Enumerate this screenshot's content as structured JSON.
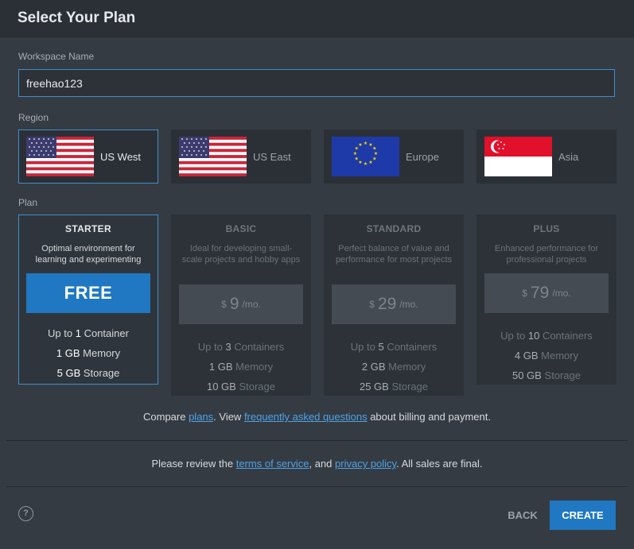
{
  "header": {
    "title": "Select Your Plan"
  },
  "workspace": {
    "label": "Workspace Name",
    "value": "freehao123"
  },
  "region": {
    "label": "Region",
    "selected": "US West",
    "items": [
      {
        "name": "US West",
        "flag": "us-flag-icon"
      },
      {
        "name": "US East",
        "flag": "us-flag-icon"
      },
      {
        "name": "Europe",
        "flag": "eu-flag-icon"
      },
      {
        "name": "Asia",
        "flag": "singapore-flag-icon"
      }
    ]
  },
  "plan": {
    "label": "Plan",
    "selected": "STARTER",
    "items": [
      {
        "name": "STARTER",
        "desc": "Optimal environment for learning and experimenting",
        "price_label": "FREE",
        "spec1_prefix": "Up to ",
        "spec1_num": "1",
        "spec1_suffix": " Container",
        "spec2_num": "1 GB",
        "spec2_suffix": " Memory",
        "spec3_num": "5 GB",
        "spec3_suffix": " Storage"
      },
      {
        "name": "BASIC",
        "desc": "Ideal for developing small-scale projects and hobby apps",
        "currency": "$",
        "amount": "9",
        "per": "/mo.",
        "spec1_prefix": "Up to ",
        "spec1_num": "3",
        "spec1_suffix": " Containers",
        "spec2_num": "1 GB",
        "spec2_suffix": " Memory",
        "spec3_num": "10 GB",
        "spec3_suffix": " Storage"
      },
      {
        "name": "STANDARD",
        "desc": "Perfect balance of value and performance for most projects",
        "currency": "$",
        "amount": "29",
        "per": "/mo.",
        "spec1_prefix": "Up to ",
        "spec1_num": "5",
        "spec1_suffix": " Containers",
        "spec2_num": "2 GB",
        "spec2_suffix": " Memory",
        "spec3_num": "25 GB",
        "spec3_suffix": " Storage"
      },
      {
        "name": "PLUS",
        "desc": "Enhanced performance for professional projects",
        "currency": "$",
        "amount": "79",
        "per": "/mo.",
        "spec1_prefix": "Up to ",
        "spec1_num": "10",
        "spec1_suffix": " Containers",
        "spec2_num": "4 GB",
        "spec2_suffix": " Memory",
        "spec3_num": "50 GB",
        "spec3_suffix": " Storage"
      }
    ]
  },
  "compare": {
    "text1": "Compare ",
    "link1": "plans",
    "text2": ". View ",
    "link2": "frequently asked questions",
    "text3": " about billing and payment."
  },
  "terms": {
    "text1": "Please review the ",
    "link1": "terms of service",
    "text2": ", and ",
    "link2": "privacy policy",
    "text3": ". All sales are final."
  },
  "footer": {
    "help": "?",
    "back": "BACK",
    "create": "CREATE"
  },
  "colors": {
    "accent": "#1f78c1",
    "link": "#4ea3e6",
    "background": "#353b43"
  }
}
